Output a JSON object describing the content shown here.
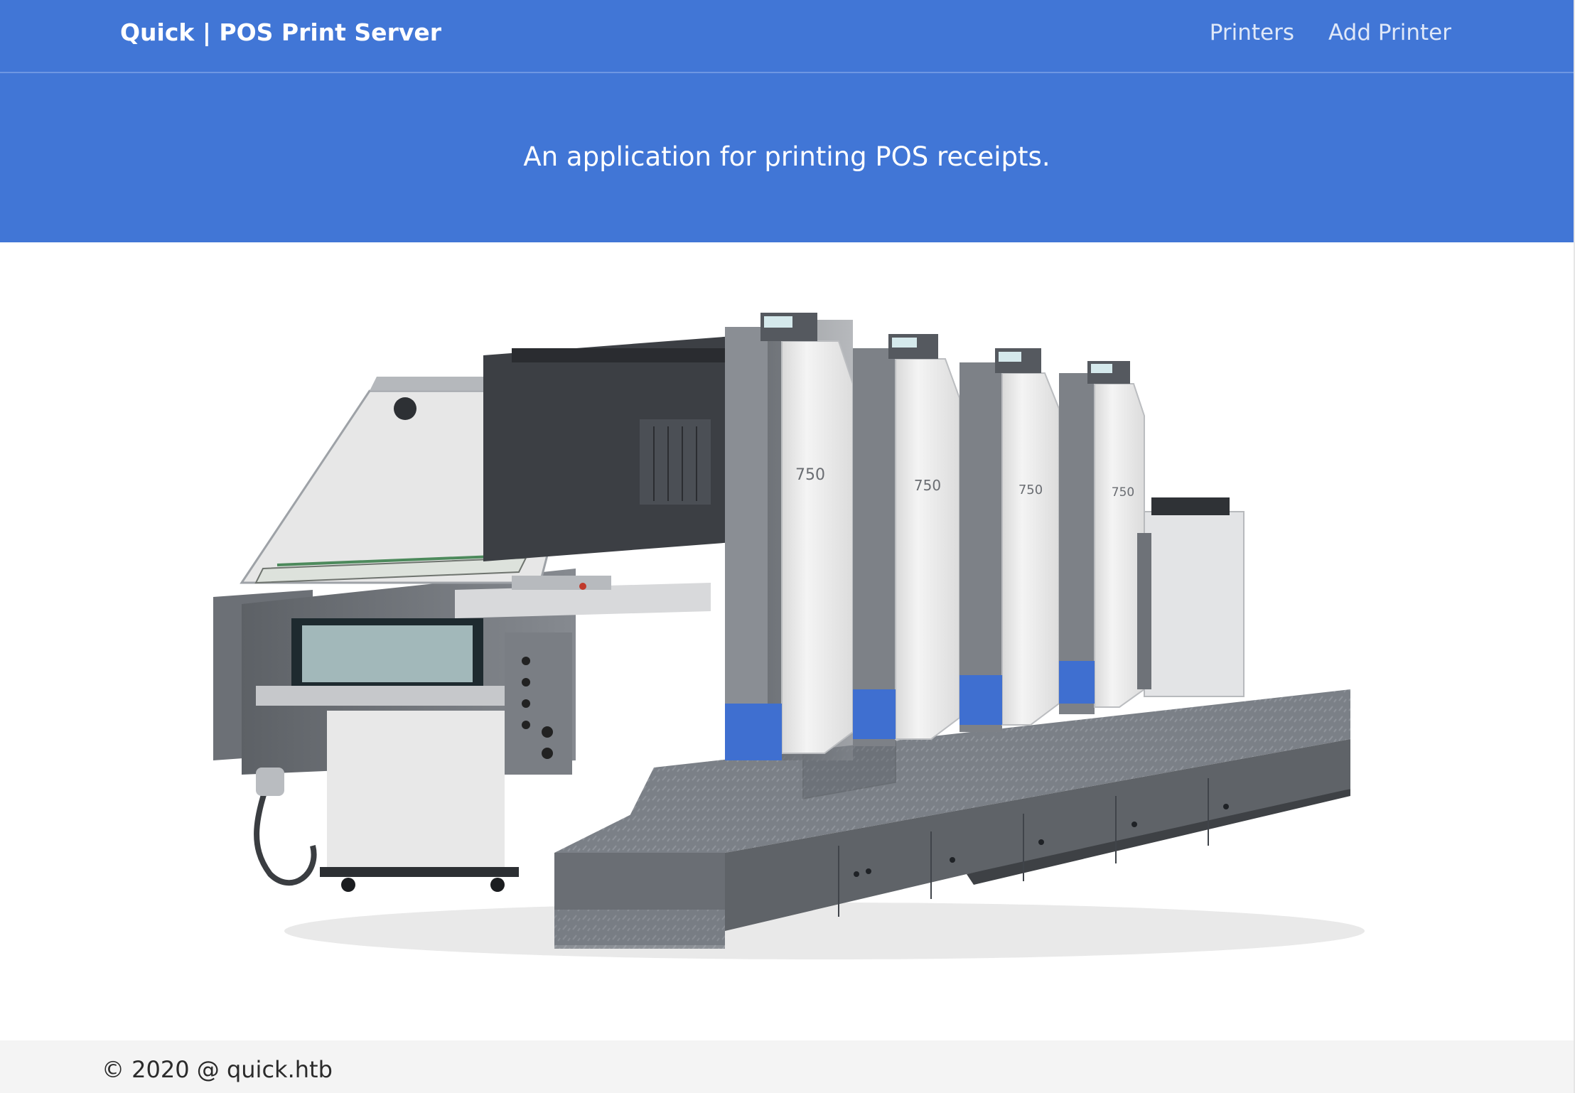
{
  "navbar": {
    "brand": "Quick | POS Print Server",
    "links": [
      {
        "label": "Printers"
      },
      {
        "label": "Add Printer"
      }
    ]
  },
  "hero": {
    "tagline": "An application for printing POS receipts."
  },
  "image": {
    "subject": "offset printing press",
    "unit_label": "750"
  },
  "footer": {
    "copyright": "© 2020 @ quick.htb"
  },
  "colors": {
    "primary": "#4176d6",
    "footer_bg": "#f4f4f4",
    "machine_white": "#efefef",
    "machine_gray": "#6f7378",
    "accent_blue": "#3f6fd0"
  }
}
